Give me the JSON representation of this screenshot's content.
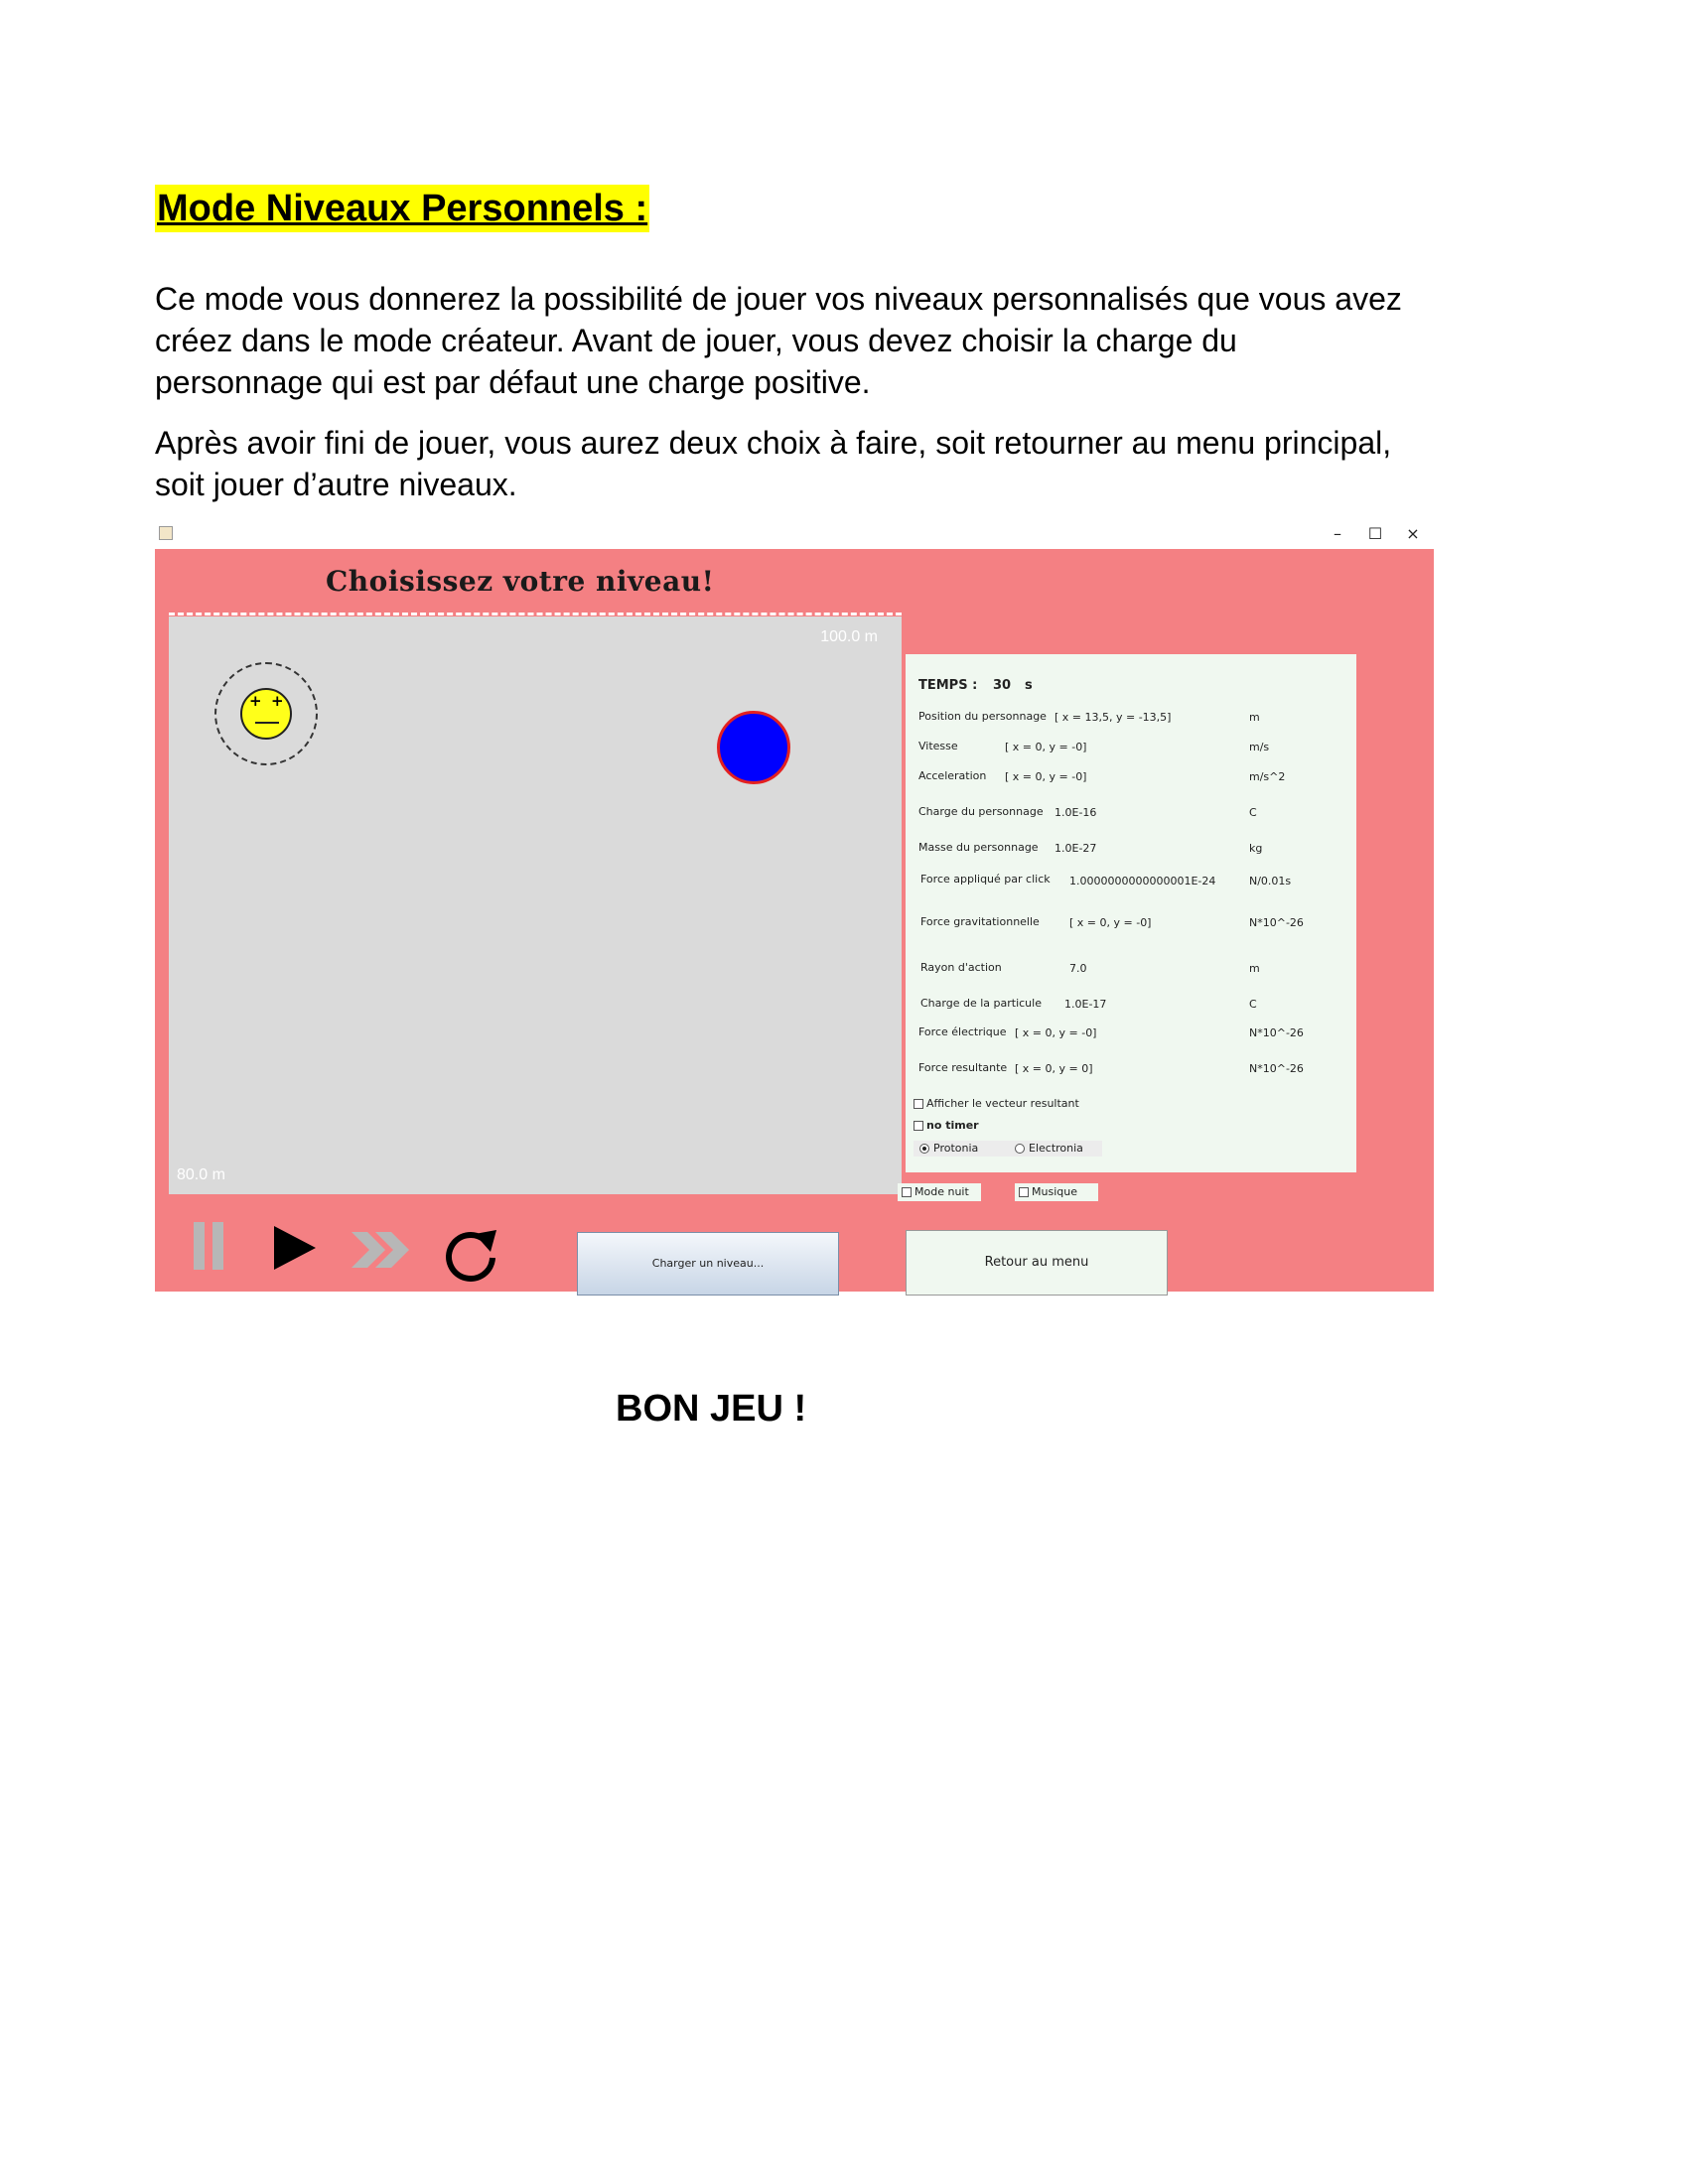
{
  "document": {
    "heading": "Mode Niveaux Personnels :",
    "paragraph1": "Ce mode vous donnerez la possibilité de jouer vos niveaux personnalisés que vous avez créez dans le mode créateur. Avant de jouer, vous devez choisir la charge du personnage qui est par défaut une charge positive.",
    "paragraph2": "Après avoir fini de jouer, vous aurez deux choix à faire, soit retourner au menu principal, soit jouer d’autre niveaux.",
    "closing": "BON JEU !"
  },
  "window": {
    "controls": {
      "minimize": "–",
      "maximize": "☐",
      "close": "×"
    }
  },
  "app": {
    "title": "Choisissez votre niveau!",
    "background_color": "#f48083",
    "arena": {
      "scale_top": "100.0 m",
      "scale_bottom": "80.0 m",
      "player_eyes": "+",
      "particle_color": "#0000ff"
    },
    "info": {
      "time_label": "TEMPS :",
      "time_value": "30",
      "time_unit": "s",
      "rows": [
        {
          "label": "Position du personnage",
          "value": "[ x = 13,5, y = -13,5]",
          "unit": "m"
        },
        {
          "label": "Vitesse",
          "value": "[ x = 0, y = -0]",
          "unit": "m/s"
        },
        {
          "label": "Acceleration",
          "value": "[ x = 0, y = -0]",
          "unit": "m/s^2"
        },
        {
          "label": "Charge du personnage",
          "value": "1.0E-16",
          "unit": "C"
        },
        {
          "label": "Masse du personnage",
          "value": "1.0E-27",
          "unit": "kg"
        },
        {
          "label": "Force appliqué par click",
          "value": "1.0000000000000001E-24",
          "unit": "N/0.01s"
        },
        {
          "label": "Force gravitationnelle",
          "value": "[ x = 0, y = -0]",
          "unit": "N*10^-26"
        },
        {
          "label": "Rayon d'action",
          "value": "7.0",
          "unit": "m"
        },
        {
          "label": "Charge de la particule",
          "value": "1.0E-17",
          "unit": "C"
        },
        {
          "label": "Force électrique",
          "value": "[ x = 0, y = -0]",
          "unit": "N*10^-26"
        },
        {
          "label": "Force resultante",
          "value": "[ x = 0, y = 0]",
          "unit": "N*10^-26"
        }
      ],
      "checkbox_vector": "Afficher le vecteur resultant",
      "checkbox_timer": "no timer",
      "radio_protonia": "Protonia",
      "radio_electronia": "Electronia"
    },
    "checkbox_night": "Mode nuit",
    "checkbox_music": "Musique",
    "load_button": "Charger un niveau...",
    "menu_button": "Retour au menu"
  }
}
